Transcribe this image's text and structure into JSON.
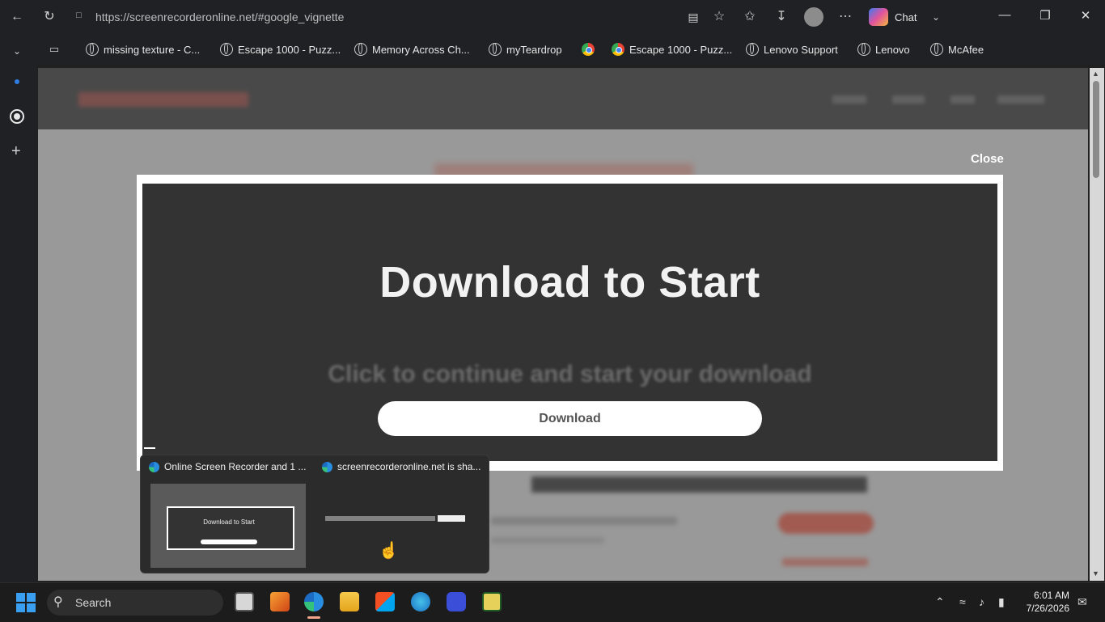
{
  "browser": {
    "url": "https://screenrecorderonline.net/#google_vignette",
    "copilot_label": "Chat",
    "bookmarks": [
      {
        "label": "missing texture - C...",
        "icon": "globe-icon"
      },
      {
        "label": "Escape 1000 - Puzz...",
        "icon": "globe-icon"
      },
      {
        "label": "Memory Across Ch...",
        "icon": "globe-icon"
      },
      {
        "label": "myTeardrop",
        "icon": "globe-icon"
      },
      {
        "label": "",
        "icon": "chrome-icon"
      },
      {
        "label": "Escape 1000 - Puzz...",
        "icon": "chrome-icon"
      },
      {
        "label": "Lenovo Support",
        "icon": "globe-icon"
      },
      {
        "label": "Lenovo",
        "icon": "globe-icon"
      },
      {
        "label": "McAfee",
        "icon": "globe-icon"
      }
    ]
  },
  "modal": {
    "close_label": "Close",
    "title": "Download to Start",
    "subtitle": "Click to continue and start your download",
    "button_label": "Download"
  },
  "preview": {
    "window1_title": "Online Screen Recorder and 1 ...",
    "window2_title": "screenrecorderonline.net is sha...",
    "thumb1_text": "Download to Start"
  },
  "taskbar": {
    "search_label": "Search",
    "time": "6:01 AM",
    "date": "7/26/2026"
  },
  "colors": {
    "modal_bg": "#333333",
    "accent_red": "#e0452e",
    "windows_blue": "#3a9ff0"
  }
}
